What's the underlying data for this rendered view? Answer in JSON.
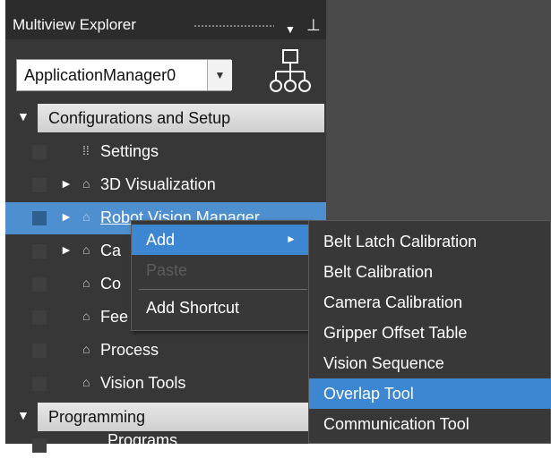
{
  "explorer": {
    "title": "Multiview Explorer",
    "title_icons": {
      "dropdown": "▼",
      "pin": "⊥"
    },
    "application_select": {
      "value": "ApplicationManager0",
      "arrow": "▼"
    },
    "hierarchy_icon": "hierarchy-icon"
  },
  "tree": {
    "config_header": {
      "arrow": "▼",
      "label": "Configurations and Setup"
    },
    "rows": [
      {
        "label": "Settings",
        "icon": "⁞⁞",
        "expander": ""
      },
      {
        "label": "3D Visualization",
        "icon": "⌂",
        "expander": "►"
      },
      {
        "label": "Robot Vision Manager",
        "icon": "⌂",
        "expander": "►"
      },
      {
        "label": "Ca",
        "icon": "⌂",
        "expander": "►"
      },
      {
        "label": "Co",
        "icon": "⌂",
        "expander": ""
      },
      {
        "label": "Fee",
        "icon": "⌂",
        "expander": ""
      },
      {
        "label": "Process",
        "icon": "⌂",
        "expander": ""
      },
      {
        "label": "Vision Tools",
        "icon": "⌂",
        "expander": ""
      }
    ],
    "programming_header": {
      "arrow": "▼",
      "label": "Programming"
    },
    "partial_row": {
      "label": "Programs"
    }
  },
  "context_menu": {
    "add": "Add",
    "add_arrow": "►",
    "paste": "Paste",
    "add_shortcut": "Add Shortcut"
  },
  "submenu": {
    "items": [
      "Belt Latch Calibration",
      "Belt Calibration",
      "Camera Calibration",
      "Gripper Offset Table",
      "Vision Sequence",
      "Overlap Tool",
      "Communication Tool"
    ],
    "highlighted": "Overlap Tool"
  },
  "colors": {
    "panel_bg": "#373737",
    "selection": "#4e8fd0",
    "menu_highlight": "#3c86d2",
    "menu_bg": "#383838"
  }
}
